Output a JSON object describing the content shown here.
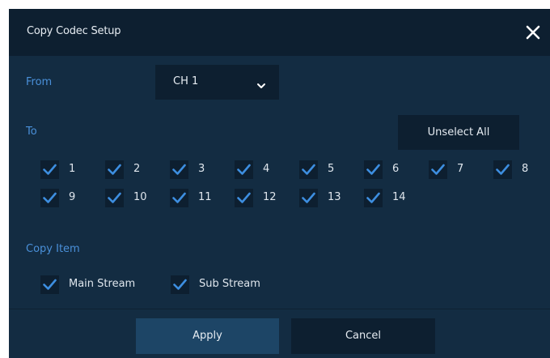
{
  "dialog": {
    "title": "Copy Codec Setup",
    "close_icon": "close-icon"
  },
  "from": {
    "label": "From",
    "selected": "CH 1",
    "arrow_icon": "chevron-down-icon"
  },
  "to": {
    "label": "To",
    "unselect_all_label": "Unselect All",
    "channels": [
      {
        "label": "1",
        "checked": true
      },
      {
        "label": "2",
        "checked": true
      },
      {
        "label": "3",
        "checked": true
      },
      {
        "label": "4",
        "checked": true
      },
      {
        "label": "5",
        "checked": true
      },
      {
        "label": "6",
        "checked": true
      },
      {
        "label": "7",
        "checked": true
      },
      {
        "label": "8",
        "checked": true
      },
      {
        "label": "9",
        "checked": true
      },
      {
        "label": "10",
        "checked": true
      },
      {
        "label": "11",
        "checked": true
      },
      {
        "label": "12",
        "checked": true
      },
      {
        "label": "13",
        "checked": true
      },
      {
        "label": "14",
        "checked": true
      }
    ]
  },
  "copy_item": {
    "label": "Copy Item",
    "items": [
      {
        "label": "Main Stream",
        "checked": true
      },
      {
        "label": "Sub Stream",
        "checked": true
      }
    ]
  },
  "footer": {
    "apply_label": "Apply",
    "cancel_label": "Cancel"
  },
  "colors": {
    "background": "#132c42",
    "panel_dark": "#0d1f30",
    "accent": "#4a90d9",
    "check": "#3d8ee0"
  }
}
